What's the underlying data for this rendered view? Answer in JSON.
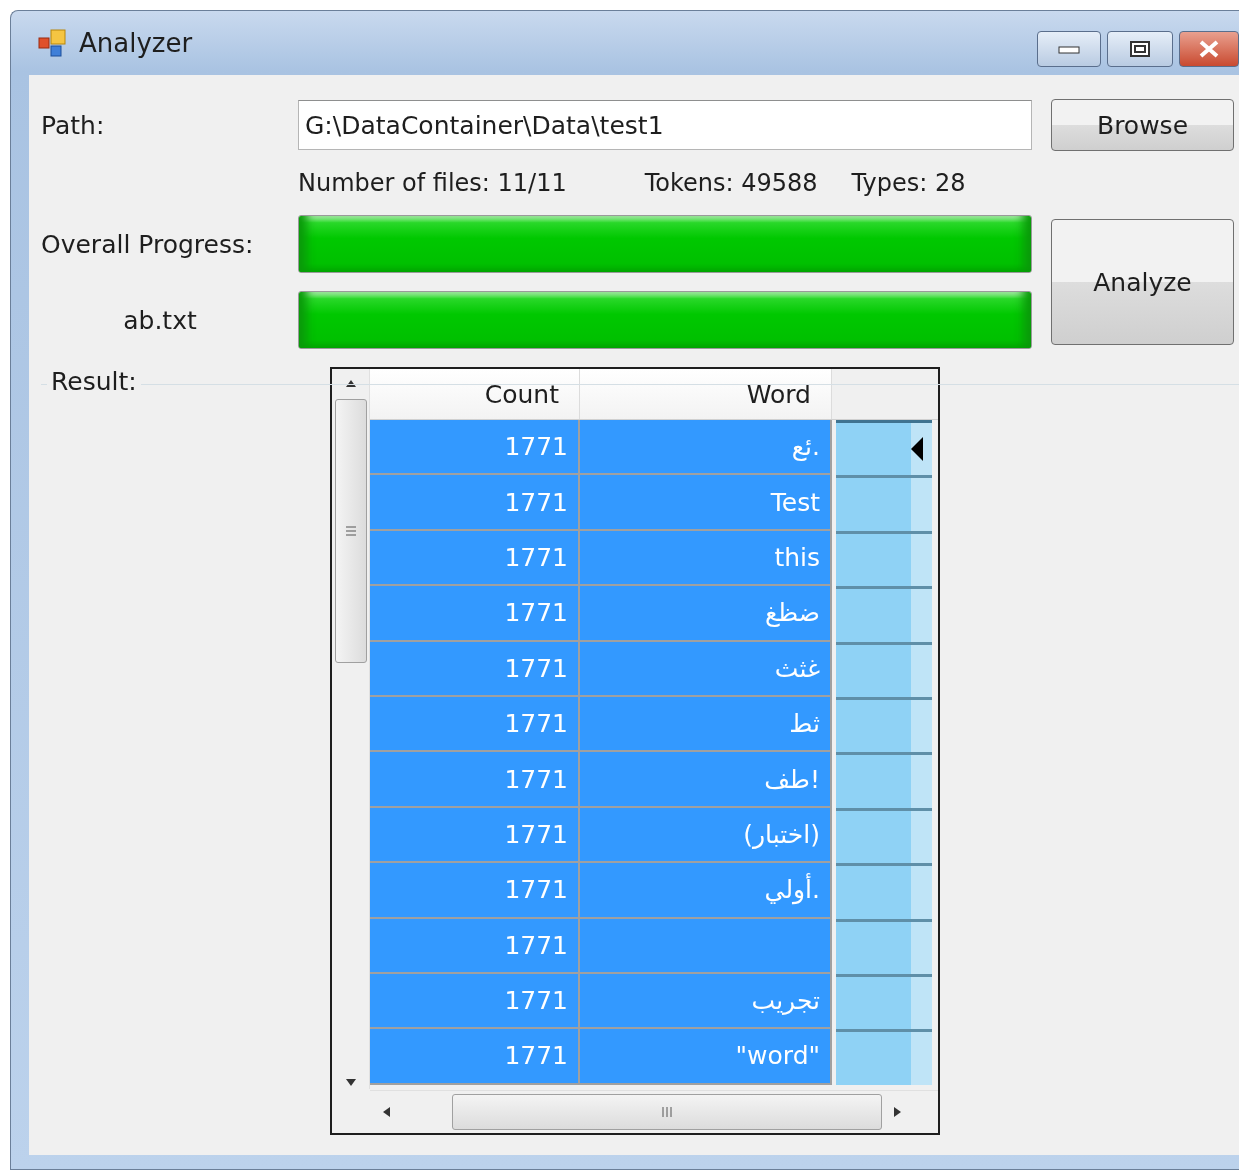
{
  "window": {
    "title": "Analyzer"
  },
  "path": {
    "label": "Path:",
    "value": "G:\\DataContainer\\Data\\test1"
  },
  "browse_button": "Browse",
  "stats": [
    "Number of files: 11/11",
    "Tokens: 49588",
    "Types: 28"
  ],
  "progress": [
    {
      "label": "Overall Progress:",
      "level": 1
    },
    {
      "label": "ab.txt",
      "level": 1
    }
  ],
  "analyze_button": "Analyze",
  "result": {
    "label": "Result:",
    "table": {
      "columns": [
        "Count",
        "Word"
      ],
      "rows": [
        {
          "count": "1771",
          "word": "ئع.",
          "selected": true,
          "current": true
        },
        {
          "count": "1771",
          "word": "Test",
          "selected": true,
          "current": false
        },
        {
          "count": "1771",
          "word": "this",
          "selected": true,
          "current": false
        },
        {
          "count": "1771",
          "word": "ضظغ",
          "selected": true,
          "current": false
        },
        {
          "count": "1771",
          "word": "غثث",
          "selected": true,
          "current": false
        },
        {
          "count": "1771",
          "word": "ثط",
          "selected": true,
          "current": false
        },
        {
          "count": "1771",
          "word": "طف!",
          "selected": true,
          "current": false
        },
        {
          "count": "1771",
          "word": "(اختبار)",
          "selected": true,
          "current": false
        },
        {
          "count": "1771",
          "word": "أولي.",
          "selected": true,
          "current": false
        },
        {
          "count": "1771",
          "selected": true,
          "current": false
        },
        {
          "count": "1771",
          "word": "تجريب",
          "selected": true,
          "current": false
        },
        {
          "count": "1771",
          "word": "\"word\"",
          "selected": true,
          "current": false
        }
      ]
    }
  }
}
